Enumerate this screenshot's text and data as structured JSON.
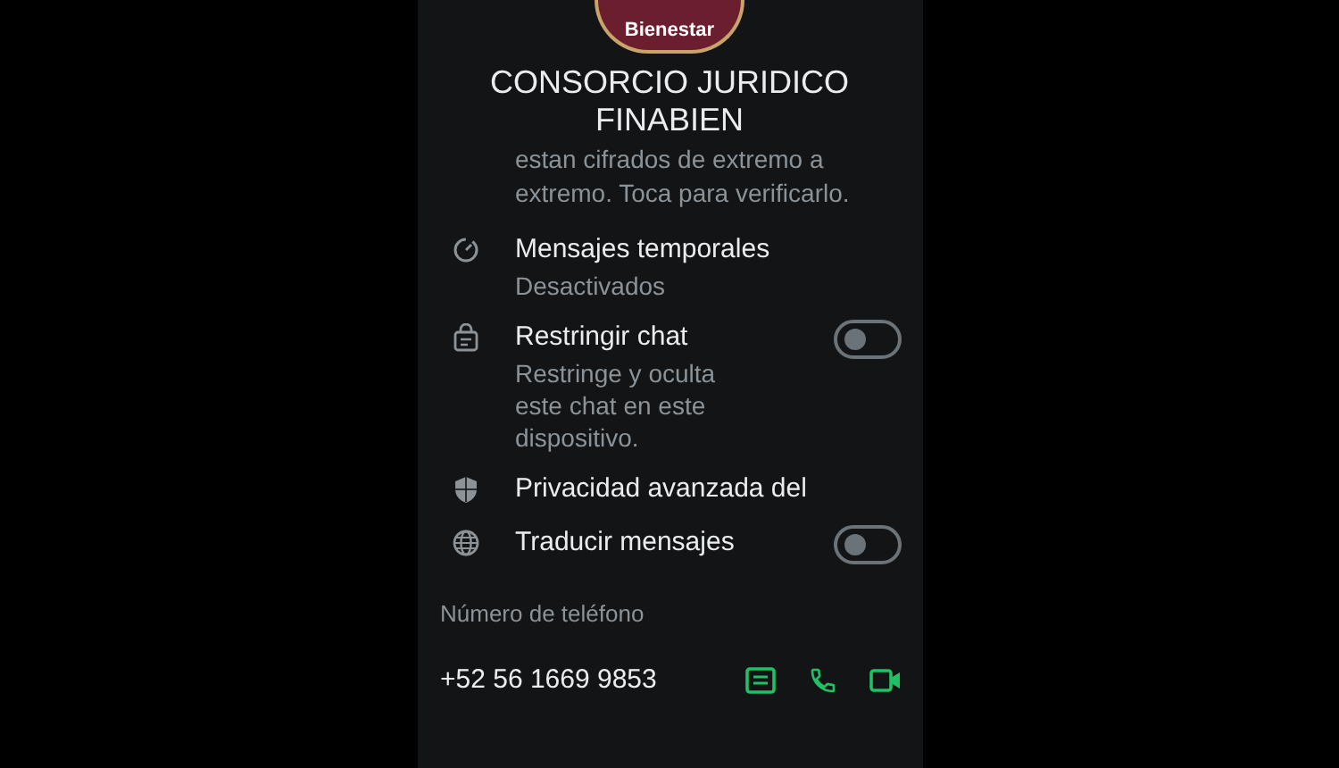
{
  "profile": {
    "logo_text": "Bienestar",
    "name_lines": [
      "CONSORCIO JURIDICO",
      "FINABIEN"
    ]
  },
  "encryption_note": {
    "lines": [
      "estan cifrados de extremo a",
      "extremo. Toca para verificarlo."
    ]
  },
  "settings": [
    {
      "kind": "timer",
      "title": "Mensajes temporales",
      "subtitle": "Desactivados"
    },
    {
      "kind": "lock-chat",
      "title": "Restringir chat",
      "subtitle": "Restringe y oculta este chat en este dispositivo.",
      "on": false
    },
    {
      "kind": "shield",
      "title": "Privacidad avanzada del"
    },
    {
      "kind": "globe",
      "title": "Traducir mensajes",
      "on": false
    }
  ],
  "phone": {
    "label": "Número de teléfono",
    "number": "+52 56 1669 9853"
  }
}
